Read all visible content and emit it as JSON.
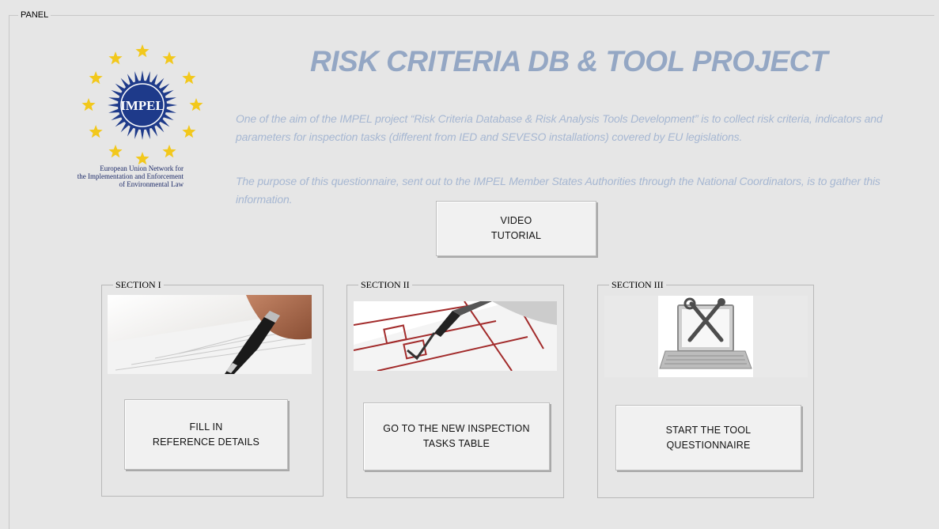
{
  "panel": {
    "legend": "PANEL"
  },
  "logo": {
    "text": "IMPEL",
    "caption": [
      "European Union Network for",
      "the Implementation and Enforcement",
      "of Environmental Law"
    ]
  },
  "header": {
    "title": "RISK CRITERIA DB & TOOL PROJECT",
    "description_1": "One of the aim of the IMPEL project “Risk Criteria Database & Risk Analysis Tools Development” is to collect risk criteria, indicators and parameters for inspection tasks (different from IED and SEVESO installations) covered by EU legislations.",
    "description_2": "The purpose of this questionnaire, sent out to the IMPEL Member States Authorities through the National Coordinators, is to gather this information."
  },
  "video_button": {
    "label": "VIDEO\nTUTORIAL"
  },
  "sections": [
    {
      "legend": "SECTION I",
      "button": "FILL IN\nREFERENCE DETAILS"
    },
    {
      "legend": "SECTION II",
      "button": "GO TO THE NEW INSPECTION\nTASKS TABLE"
    },
    {
      "legend": "SECTION III",
      "button": "START THE TOOL\nQUESTIONNAIRE"
    }
  ],
  "colors": {
    "title": "#94a7c4",
    "description": "#a6b7d2",
    "background": "#e6e6e6",
    "logo_blue": "#1e3a8a",
    "star_yellow": "#f2c81c"
  }
}
